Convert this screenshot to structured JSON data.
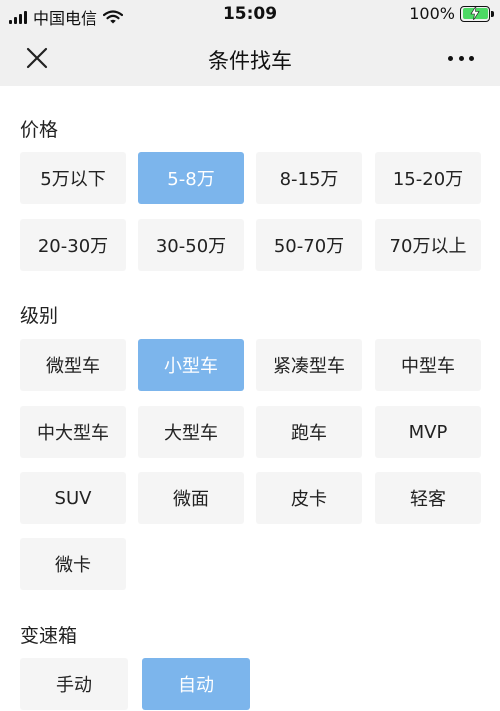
{
  "status_bar": {
    "carrier": "中国电信",
    "time": "15:09",
    "battery": "100%"
  },
  "nav": {
    "title": "条件找车"
  },
  "price": {
    "title": "价格",
    "options": [
      "5万以下",
      "5-8万",
      "8-15万",
      "15-20万",
      "20-30万",
      "30-50万",
      "50-70万",
      "70万以上"
    ],
    "selected": "5-8万"
  },
  "level": {
    "title": "级别",
    "options": [
      "微型车",
      "小型车",
      "紧凑型车",
      "中型车",
      "中大型车",
      "大型车",
      "跑车",
      "MVP",
      "SUV",
      "微面",
      "皮卡",
      "轻客",
      "微卡"
    ],
    "selected": "小型车"
  },
  "transmission": {
    "title": "变速箱",
    "options": [
      "手动",
      "自动"
    ],
    "selected": "自动"
  },
  "colors": {
    "selected_bg": "#7cb5ec",
    "option_bg": "#f5f5f5",
    "bar_bg": "#f0f0f0",
    "battery_green": "#4cd964"
  }
}
